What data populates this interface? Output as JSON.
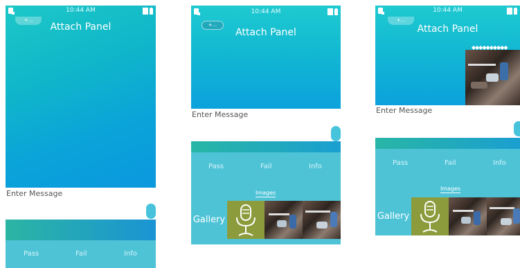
{
  "status": {
    "time": "10:44 AM"
  },
  "app": {
    "title": "Attach Panel",
    "plus_button": "+...",
    "message_placeholder": "Enter Message"
  },
  "panel": {
    "tabs": [
      "Pass",
      "Fail",
      "Info"
    ],
    "images_tab": "Images",
    "gallery": "Gallery"
  },
  "colors": {
    "accent": "#4ec3d6",
    "gradient_start": "#1dc8c8",
    "gradient_end": "#0b98df"
  },
  "icons": {
    "status_left": "sim-card-icon",
    "status_right": "battery-icon",
    "thumb_mic": "microphone-icon"
  }
}
